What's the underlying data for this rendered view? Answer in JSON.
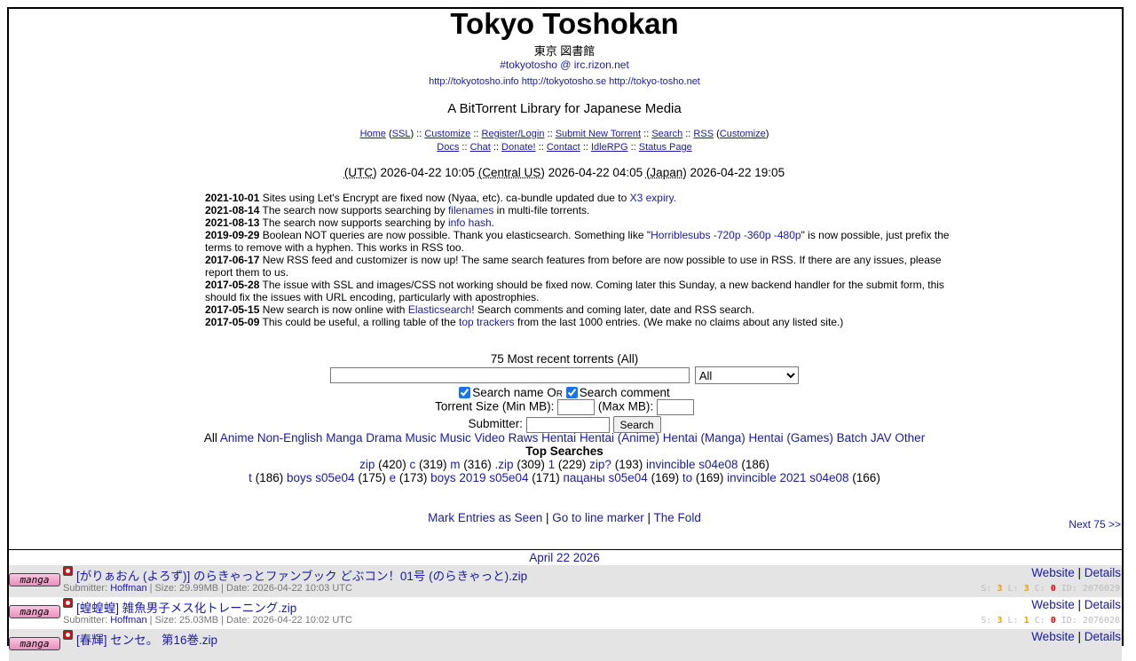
{
  "site": {
    "title": "Tokyo Toshokan",
    "japanese_title": "東京 図書館",
    "irc": "#tokyotosho @ irc.rizon.net",
    "mirrors": [
      "http://tokyotosho.info",
      "http://tokyotosho.se",
      "http://tokyo-tosho.net"
    ],
    "tagline": "A BitTorrent Library for Japanese Media"
  },
  "nav": {
    "home": "Home",
    "ssl": "SSL",
    "customize": "Customize",
    "register": "Register/Login",
    "submit": "Submit New Torrent",
    "search": "Search",
    "rss": "RSS",
    "rss_customize": "Customize",
    "docs": "Docs",
    "chat": "Chat",
    "donate": "Donate!",
    "contact": "Contact",
    "idlerpg": "IdleRPG",
    "status": "Status Page"
  },
  "clock": {
    "utc_label": "(UTC)",
    "utc_time": "2026-04-22 10:05",
    "us_label": "(Central US)",
    "us_time": "2026-04-22 04:05",
    "jp_label": "(Japan)",
    "jp_time": "2026-04-22 19:05"
  },
  "news": [
    {
      "date": "2021-10-01",
      "pre": "Sites using Let's Encrypt are fixed now (Nyaa, etc). ca-bundle updated due to ",
      "link": "X3 expiry.",
      "post": ""
    },
    {
      "date": "2021-08-14",
      "pre": "The search now supports searching by ",
      "link": "filenames",
      "post": " in multi-file torrents."
    },
    {
      "date": "2021-08-13",
      "pre": "The search now supports searching by ",
      "link": "info hash",
      "post": "."
    },
    {
      "date": "2019-09-29",
      "pre": "Boolean NOT queries are now possible. Thank you elasticsearch. Something like \"",
      "link": "Horriblesubs -720p -360p -480p",
      "post": "\" is now possible, just prefix the terms to remove with a hyphen. This works in RSS too."
    },
    {
      "date": "2017-06-17",
      "pre": "New RSS feed and customizer is now up! The same search features from before are now possible to use in RSS. If there are any issues, please report them to us.",
      "link": "",
      "post": ""
    },
    {
      "date": "2017-05-28",
      "pre": "The issue with SSL and images/CSS not working should be fixed now. Coming later this Sunday, a new backend handler for the submit form, this should fix the issues with URL encoding, particularly with apostrophies.",
      "link": "",
      "post": ""
    },
    {
      "date": "2017-05-15",
      "pre": "New search is now online with ",
      "link": "Elasticsearch",
      "post": "! Search comments and coming later, date and RSS search."
    },
    {
      "date": "2017-05-09",
      "pre": "This could be useful, a rolling table of the ",
      "link": "top trackers",
      "post": " from the last 1000 entries. (We make no claims about any listed site.)"
    }
  ],
  "search": {
    "heading": "75 Most recent torrents (All)",
    "query_value": "",
    "category_selected": "All",
    "search_name_label": "Search name",
    "or_label": "Or",
    "search_comment_label": "Search comment",
    "size_label": "Torrent Size (Min MB):",
    "max_label": "(Max MB):",
    "submitter_label": "Submitter:",
    "button": "Search"
  },
  "categories": {
    "current": "All",
    "links": [
      "Anime",
      "Non-English",
      "Manga",
      "Drama",
      "Music",
      "Music Video",
      "Raws",
      "Hentai",
      "Hentai (Anime)",
      "Hentai (Manga)",
      "Hentai (Games)",
      "Batch",
      "JAV",
      "Other"
    ]
  },
  "top_searches": {
    "heading": "Top Searches",
    "row1": [
      {
        "term": "zip",
        "count": "(420)"
      },
      {
        "term": "c",
        "count": "(319)"
      },
      {
        "term": "m",
        "count": "(316)"
      },
      {
        "term": ".zip",
        "count": "(309)"
      },
      {
        "term": "1",
        "count": "(229)"
      },
      {
        "term": "zip?",
        "count": "(193)"
      },
      {
        "term": "invincible s04e08",
        "count": "(186)"
      }
    ],
    "row2": [
      {
        "term": "t",
        "count": "(186)"
      },
      {
        "term": "boys s05e04",
        "count": "(175)"
      },
      {
        "term": "e",
        "count": "(173)"
      },
      {
        "term": "boys 2019 s05e04",
        "count": "(171)"
      },
      {
        "term": "пацаны s05e04",
        "count": "(169)"
      },
      {
        "term": "to",
        "count": "(169)"
      },
      {
        "term": "invincible 2021 s04e08",
        "count": "(166)"
      }
    ]
  },
  "marks": {
    "seen": "Mark Entries as Seen",
    "line": "Go to line marker",
    "fold": "The Fold",
    "next": "Next 75 >>"
  },
  "listing": {
    "date_header": "April 22 2026",
    "entries": [
      {
        "badge": "manga",
        "title": "[がりぁおん (よろず)] のらきゃっとファンブック どぶコン！01号 (のらきゃっと).zip",
        "submitter": "Hoffman",
        "size": "29.99MB",
        "date": "2026-04-22 10:03 UTC",
        "S": "3",
        "L": "3",
        "C": "0",
        "ID": "2076029",
        "website": "Website",
        "details": "Details"
      },
      {
        "badge": "manga",
        "title": "[蝗蝗蝗] 雑魚男子メス化トレーニング.zip",
        "submitter": "Hoffman",
        "size": "25.03MB",
        "date": "2026-04-22 10:02 UTC",
        "S": "3",
        "L": "1",
        "C": "0",
        "ID": "2076028",
        "website": "Website",
        "details": "Details"
      },
      {
        "badge": "manga",
        "title": "[春輝] センセ。 第16巻.zip",
        "submitter": "",
        "size": "",
        "date": "",
        "S": "",
        "L": "",
        "C": "",
        "ID": "",
        "website": "Website",
        "details": "Details"
      }
    ]
  }
}
